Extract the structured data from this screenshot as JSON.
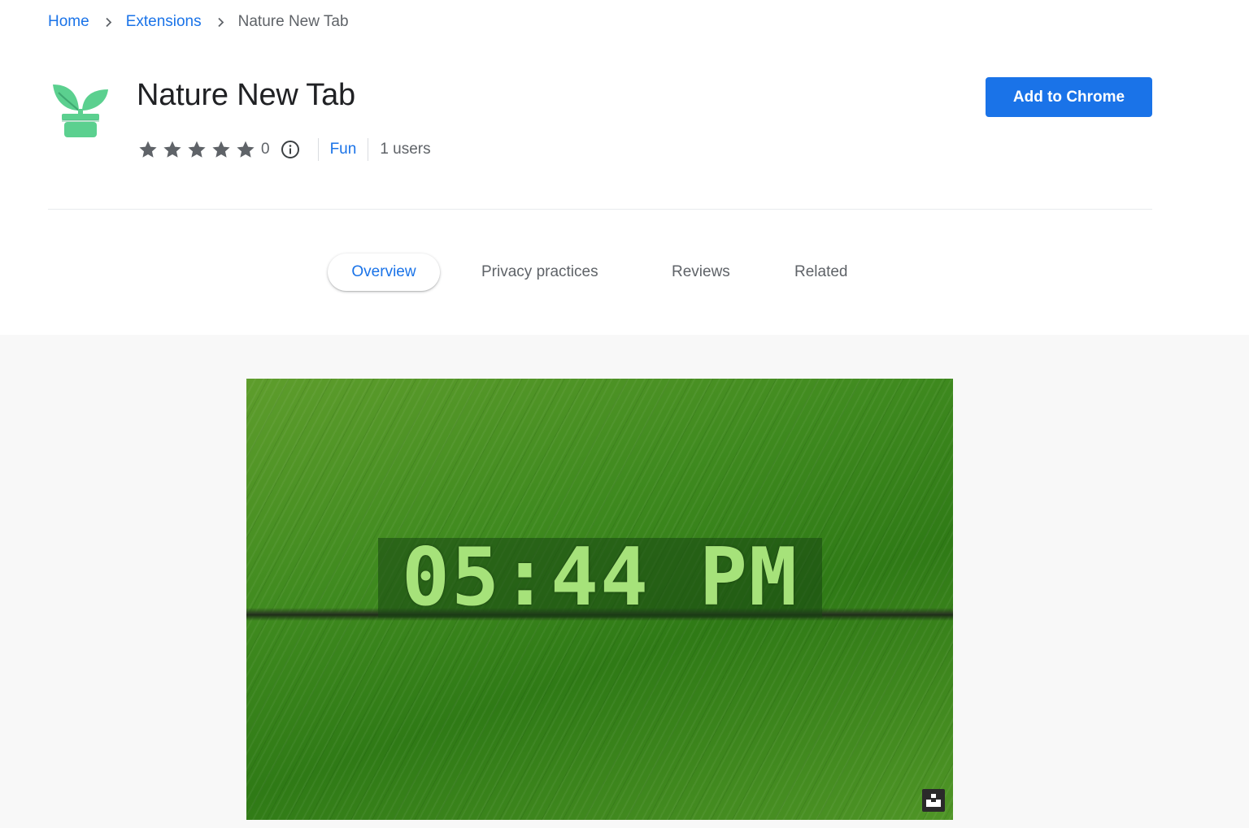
{
  "breadcrumb": {
    "items": [
      "Home",
      "Extensions"
    ],
    "current": "Nature New Tab"
  },
  "extension": {
    "name": "Nature New Tab",
    "icon": "plant-pot-icon",
    "icon_color": "#5bd08f",
    "rating_stars": 0,
    "rating_count": "0",
    "category": "Fun",
    "users": "1 users"
  },
  "actions": {
    "add_label": "Add to Chrome",
    "accent_color": "#1a73e8"
  },
  "tabs": [
    {
      "label": "Overview",
      "active": true
    },
    {
      "label": "Privacy practices",
      "active": false
    },
    {
      "label": "Reviews",
      "active": false
    },
    {
      "label": "Related",
      "active": false
    }
  ],
  "screenshot": {
    "clock_text": "05:44 PM",
    "corner_icon": "unsplash-icon"
  }
}
